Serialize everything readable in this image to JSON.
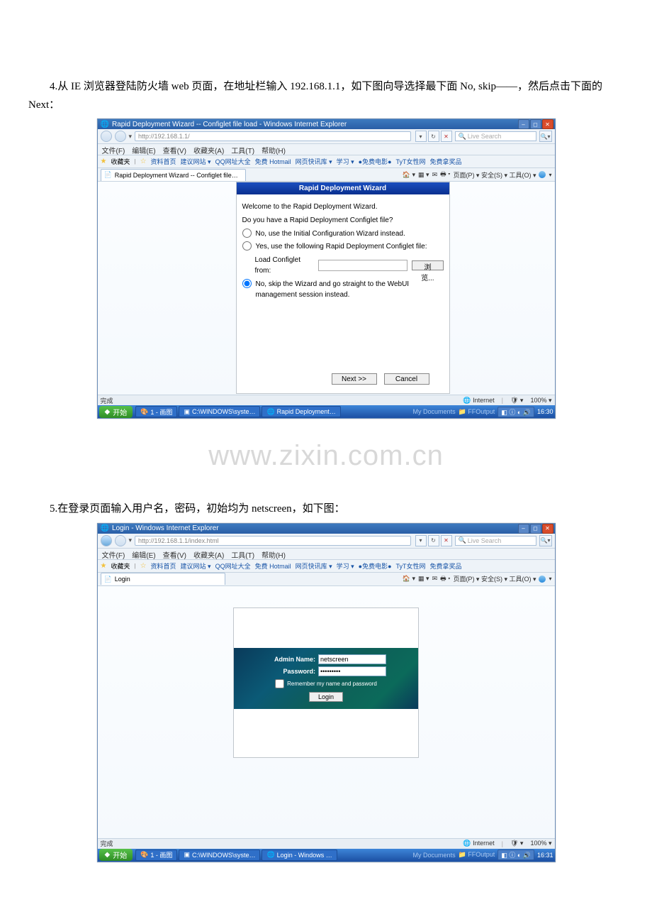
{
  "para4": "4.从 IE 浏览器登陆防火墙 web 页面，在地址栏输入 192.168.1.1，如下图向导选择最下面 No, skip――，然后点击下面的 Next：",
  "para5": "5.在登录页面输入用户名，密码，初始均为 netscreen，如下图：",
  "watermark": "www.zixin.com.cn",
  "ie1": {
    "title": "Rapid Deployment Wizard -- Configlet file load - Windows Internet Explorer",
    "url": "http://192.168.1.1/",
    "search_placeholder": "Live Search",
    "menu": [
      "文件(F)",
      "编辑(E)",
      "查看(V)",
      "收藏夹(A)",
      "工具(T)",
      "帮助(H)"
    ],
    "fav_label": "收藏夹",
    "fav_items": [
      "资料首页",
      "建议网站 ▾",
      "QQ网址大全",
      "免费 Hotmail",
      "网页快讯库 ▾",
      "学习 ▾",
      "●免费电影●",
      "TyT女性网",
      "免费拿奖品"
    ],
    "tab_label": "Rapid Deployment Wizard -- Configlet file…",
    "right_tools": "页面(P) ▾  安全(S) ▾  工具(O) ▾",
    "status_left": "完成",
    "status_right": "Internet",
    "zoom": "100%  ▾"
  },
  "wizard": {
    "title": "Rapid Deployment Wizard",
    "welcome": "Welcome to the Rapid Deployment Wizard.",
    "question": "Do you have a Rapid Deployment Configlet file?",
    "opt1": "No, use the Initial Configuration Wizard instead.",
    "opt2": "Yes, use the following Rapid Deployment Configlet file:",
    "load_label": "Load Configlet from:",
    "browse": "浏览...",
    "opt3": "No, skip the Wizard and go straight to the WebUI management session instead.",
    "next": "Next >>",
    "cancel": "Cancel"
  },
  "taskbar1": {
    "start": "开始",
    "btn1": "1 - 画图",
    "btn2": "C:\\WINDOWS\\syste…",
    "btn3": "Rapid Deployment…",
    "mydoc": "My Documents",
    "ffout": "FFOutput",
    "time": "16:30"
  },
  "ie2": {
    "title": "Login - Windows Internet Explorer",
    "url": "http://192.168.1.1/index.html",
    "tab_label": "Login",
    "status_left": "完成",
    "status_right": "Internet",
    "zoom": "100%  ▾"
  },
  "login": {
    "name_label": "Admin Name:",
    "name_value": "netscreen",
    "pass_label": "Password:",
    "pass_value": "•••••••••",
    "remember": "Remember my name and password",
    "button": "Login"
  },
  "taskbar2": {
    "start": "开始",
    "btn1": "1 - 画图",
    "btn2": "C:\\WINDOWS\\syste…",
    "btn3": "Login - Windows …",
    "mydoc": "My Documents",
    "ffout": "FFOutput",
    "time": "16:31"
  }
}
